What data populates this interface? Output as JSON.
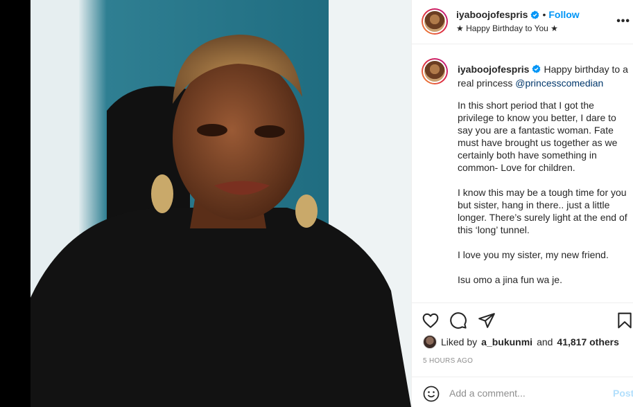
{
  "post": {
    "username": "iyaboojofespris",
    "follow_label": "Follow",
    "dot": "•",
    "location": "★ Happy Birthday to You ★",
    "more": "•••"
  },
  "caption": {
    "username": "iyaboojofespris",
    "lead": "Happy birthday to a real princess",
    "mention": "@princesscomedian",
    "paragraphs": [
      "In this short period that I got the privilege to know you better, I dare to say you are a fantastic woman. Fate must have brought us together as we certainly both have something in common- Love for children.",
      "I know this may be a tough time for you but sister, hang in there.. just a little longer. There’s surely light at the end of this ‘long’ tunnel.",
      "I love you my sister, my new friend.",
      "Isu omo a jina fun wa je."
    ]
  },
  "likes": {
    "prefix": "Liked by",
    "user": "a_bukunmi",
    "and": "and",
    "count": "41,817 others"
  },
  "timestamp": "5 HOURS AGO",
  "comment": {
    "placeholder": "Add a comment...",
    "post_label": "Post"
  },
  "icons": {
    "like": "heart-icon",
    "comment": "comment-icon",
    "share": "share-icon",
    "save": "bookmark-icon",
    "emoji": "smiley-icon",
    "verified": "verified-badge-icon"
  },
  "colors": {
    "accent": "#0095f6",
    "mention": "#00376b",
    "post_disabled": "#b2dffc",
    "muted": "#8e8e8e"
  }
}
